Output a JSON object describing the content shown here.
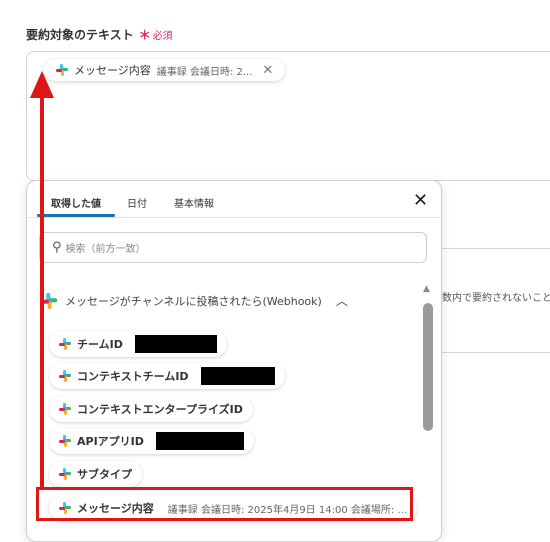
{
  "field": {
    "label": "要約対象のテキスト",
    "required_mark": "＊",
    "required_text": "必須"
  },
  "chip": {
    "icon": "slack-icon",
    "label": "メッセージ内容",
    "sub": "議事録 会議日時: 2...",
    "remove": "✕"
  },
  "background": {
    "helper_fragment": "数内で要約されないことが"
  },
  "panel": {
    "tabs": [
      {
        "label": "取得した値",
        "active": true
      },
      {
        "label": "日付",
        "active": false
      },
      {
        "label": "基本情報",
        "active": false
      }
    ],
    "close": "✕",
    "search": {
      "icon": "search-icon",
      "placeholder": "検索（前方一致）"
    },
    "group": {
      "label": "メッセージがチャンネルに投稿されたら(Webhook)",
      "caret": "︿"
    },
    "items": [
      {
        "label": "チームID",
        "redacted": true
      },
      {
        "label": "コンテキストチームID",
        "redacted": true
      },
      {
        "label": "コンテキストエンタープライズID",
        "redacted": false
      },
      {
        "label": "APIアプリID",
        "redacted": true
      },
      {
        "label": "サブタイプ",
        "redacted": false
      },
      {
        "label": "メッセージ内容",
        "sub": "議事録 会議日時: 2025年4月9日 14:00 会議場所: ...",
        "highlighted": true
      }
    ]
  },
  "colors": {
    "annotation_red": "#e01515",
    "required_red": "#e0245e",
    "tab_accent": "#1a73b0"
  }
}
